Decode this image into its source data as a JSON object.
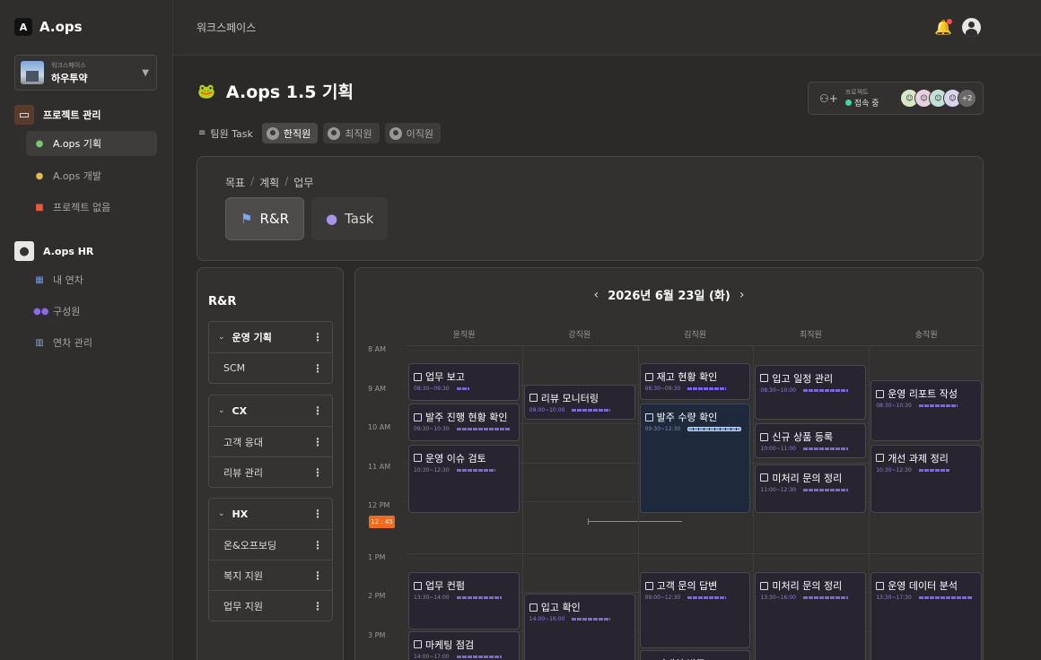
{
  "app": {
    "logo_mark": "A",
    "name": "A.ops"
  },
  "workspace": {
    "label": "워크스페이스",
    "name": "하우투약"
  },
  "sidebar": {
    "sections": [
      {
        "label": "프로젝트 관리",
        "icon": "signboard-icon",
        "items": [
          {
            "label": "A.ops 기획",
            "icon": "frog-icon",
            "active": true
          },
          {
            "label": "A.ops 개발",
            "icon": "coin-icon",
            "active": false
          },
          {
            "label": "프로젝트 없음",
            "icon": "gift-icon",
            "active": false
          }
        ]
      },
      {
        "label": "A.ops HR",
        "icon": "person-icon",
        "items": [
          {
            "label": "내 연차",
            "icon": "calendar-icon",
            "active": false
          },
          {
            "label": "구성원",
            "icon": "group-icon",
            "active": false
          },
          {
            "label": "연차 관리",
            "icon": "building-icon",
            "active": false
          }
        ]
      }
    ]
  },
  "topbar": {
    "title": "워크스페이스"
  },
  "project": {
    "name": "A.ops 1.5 기획"
  },
  "presence": {
    "label": "프로젝트",
    "status": "접속 중",
    "more": "+2",
    "avatar_colors": [
      "#d6e8c4",
      "#e8d0e0",
      "#c4e0d6",
      "#d8d4ec"
    ]
  },
  "filters": {
    "label": "팀원 Task",
    "chips": [
      {
        "label": "한직원",
        "active": true
      },
      {
        "label": "최직원",
        "active": false
      },
      {
        "label": "이직원",
        "active": false
      }
    ]
  },
  "mode": {
    "crumbs": [
      "목표",
      "계획",
      "업무"
    ],
    "buttons": [
      {
        "label": "R&R",
        "active": true
      },
      {
        "label": "Task",
        "active": false
      }
    ]
  },
  "rr": {
    "title": "R&R",
    "groups": [
      {
        "name": "운영 기획",
        "items": [
          "SCM"
        ]
      },
      {
        "name": "CX",
        "items": [
          "고객 응대",
          "리뷰 관리"
        ]
      },
      {
        "name": "HX",
        "items": [
          "온&오프보딩",
          "복지 지원",
          "업무 지원"
        ]
      }
    ]
  },
  "calendar": {
    "date_label": "2026년 6월 23일 (화)",
    "members": [
      "윤직원",
      "강직원",
      "김직원",
      "최직원",
      "송직원"
    ],
    "hours": [
      "8 AM",
      "9 AM",
      "10 AM",
      "11 AM",
      "12 PM",
      "1 PM",
      "2 PM",
      "3 PM"
    ],
    "now_label": "12 : 45",
    "tasks": [
      {
        "col": 0,
        "start": 8.47,
        "end": 9.47,
        "title": "업무 보고",
        "time": "08:30~09:30",
        "bar": 0.12
      },
      {
        "col": 0,
        "start": 9.5,
        "end": 10.5,
        "title": "발주 진행 현황 확인",
        "time": "09:30~10:30",
        "bar": 0.5
      },
      {
        "col": 0,
        "start": 10.55,
        "end": 12.35,
        "title": "운영 이슈 검토",
        "time": "10:30~12:30",
        "bar": 0.36
      },
      {
        "col": 0,
        "start": 13.5,
        "end": 15.0,
        "title": "업무 컨펌",
        "time": "13:30~14:00",
        "bar": 0.42
      },
      {
        "col": 0,
        "start": 15.0,
        "end": 16.2,
        "title": "마케팅 점검",
        "time": "14:00~17:00",
        "bar": 0.42
      },
      {
        "col": 1,
        "start": 9.0,
        "end": 9.95,
        "title": "리뷰 모니터링",
        "time": "09:00~10:00",
        "bar": 0.36
      },
      {
        "col": 1,
        "start": 14.05,
        "end": 16.0,
        "title": "입고 확인",
        "time": "14:00~16:00",
        "bar": 0.36
      },
      {
        "col": 2,
        "start": 8.47,
        "end": 9.45,
        "title": "재고 현황 확인",
        "time": "08:30~09:30",
        "bar": 0.36
      },
      {
        "col": 2,
        "start": 9.5,
        "end": 12.35,
        "title": "발주 수량 확인",
        "time": "09:30~12:30",
        "bar": 0.5,
        "selected": true
      },
      {
        "col": 2,
        "start": 13.5,
        "end": 15.5,
        "title": "고객 문의 답변",
        "time": "09:00~12:30",
        "bar": 0.36
      },
      {
        "col": 2,
        "start": 15.5,
        "end": 16.5,
        "title": "거래처 발주",
        "time": "",
        "bar": 0
      },
      {
        "col": 3,
        "start": 8.5,
        "end": 9.95,
        "title": "입고 일정 관리",
        "time": "08:30~10:00",
        "bar": 0.42
      },
      {
        "col": 3,
        "start": 10.0,
        "end": 10.95,
        "title": "신규 상품 등록",
        "time": "10:00~11:00",
        "bar": 0.42
      },
      {
        "col": 3,
        "start": 11.05,
        "end": 12.35,
        "title": "미처리 문의 정리",
        "time": "11:00~12:30",
        "bar": 0.42
      },
      {
        "col": 3,
        "start": 13.5,
        "end": 16.5,
        "title": "미처리 문의 정리",
        "time": "13:30~16:00",
        "bar": 0.42
      },
      {
        "col": 4,
        "start": 8.9,
        "end": 10.5,
        "title": "운영 리포트 작성",
        "time": "08:30~10:30",
        "bar": 0.36
      },
      {
        "col": 4,
        "start": 10.55,
        "end": 12.35,
        "title": "개선 과제 정리",
        "time": "10:30~12:30",
        "bar": 0.28
      },
      {
        "col": 4,
        "start": 13.5,
        "end": 16.5,
        "title": "운영 데이터 분석",
        "time": "13:30~17:30",
        "bar": 0.5
      }
    ]
  }
}
